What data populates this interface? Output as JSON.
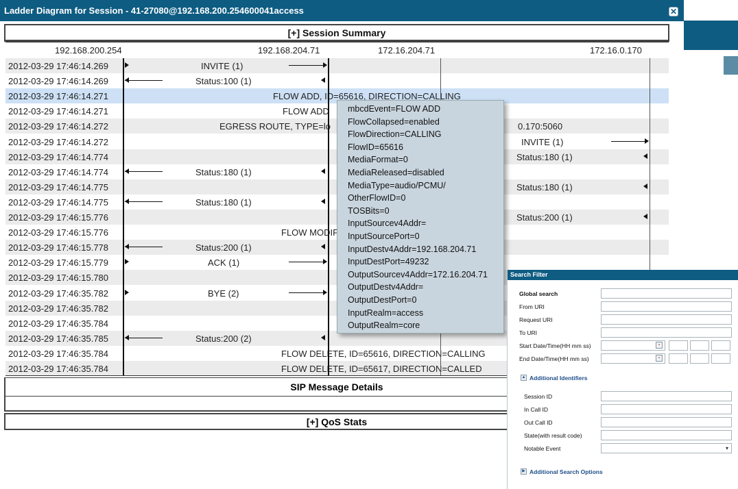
{
  "window": {
    "title": "Ladder Diagram for Session - 41-27080@192.168.200.254600041access",
    "close_glyph": "✕"
  },
  "sections": {
    "session_summary": "[+] Session Summary",
    "sip_details": "SIP Message Details",
    "qos_stats": "[+] QoS Stats"
  },
  "ladder": {
    "ips": [
      "192.168.200.254",
      "192.168.204.71",
      "172.16.204.71",
      "172.16.0.170"
    ],
    "rows": [
      {
        "ts": "2012-03-29 17:46:14.269",
        "label": "INVITE (1)"
      },
      {
        "ts": "2012-03-29 17:46:14.269",
        "label": "Status:100 (1)"
      },
      {
        "ts": "2012-03-29 17:46:14.271",
        "label": "FLOW ADD, ID=65616, DIRECTION=CALLING"
      },
      {
        "ts": "2012-03-29 17:46:14.271",
        "label": "FLOW ADD"
      },
      {
        "ts": "2012-03-29 17:46:14.272",
        "label": "EGRESS ROUTE, TYPE=lo",
        "label2": "0.170:5060"
      },
      {
        "ts": "2012-03-29 17:46:14.272",
        "label": "INVITE (1)"
      },
      {
        "ts": "2012-03-29 17:46:14.774",
        "label": "Status:180 (1)"
      },
      {
        "ts": "2012-03-29 17:46:14.774",
        "label": "Status:180 (1)"
      },
      {
        "ts": "2012-03-29 17:46:14.775",
        "label": "Status:180 (1)"
      },
      {
        "ts": "2012-03-29 17:46:14.775",
        "label": "Status:180 (1)"
      },
      {
        "ts": "2012-03-29 17:46:15.776",
        "label": "Status:200 (1)"
      },
      {
        "ts": "2012-03-29 17:46:15.776",
        "label": "FLOW MODIF"
      },
      {
        "ts": "2012-03-29 17:46:15.778",
        "label": "Status:200 (1)"
      },
      {
        "ts": "2012-03-29 17:46:15.779",
        "label": "ACK (1)"
      },
      {
        "ts": "2012-03-29 17:46:15.780",
        "label": ""
      },
      {
        "ts": "2012-03-29 17:46:35.782",
        "label": "BYE (2)"
      },
      {
        "ts": "2012-03-29 17:46:35.782",
        "label": ""
      },
      {
        "ts": "2012-03-29 17:46:35.784",
        "label": ""
      },
      {
        "ts": "2012-03-29 17:46:35.785",
        "label": "Status:200 (2)"
      },
      {
        "ts": "2012-03-29 17:46:35.784",
        "label": "FLOW DELETE, ID=65616, DIRECTION=CALLING"
      },
      {
        "ts": "2012-03-29 17:46:35.784",
        "label": "FLOW DELETE, ID=65617, DIRECTION=CALLED"
      }
    ]
  },
  "tooltip": {
    "lines": [
      "mbcdEvent=FLOW ADD",
      "FlowCollapsed=enabled",
      "FlowDirection=CALLING",
      "FlowID=65616",
      "MediaFormat=0",
      "MediaReleased=disabled",
      "MediaType=audio/PCMU/",
      "OtherFlowID=0",
      "TOSBits=0",
      "InputSourcev4Addr=",
      "InputSourcePort=0",
      "InputDestv4Addr=192.168.204.71",
      "InputDestPort=49232",
      "OutputSourcev4Addr=172.16.204.71",
      "OutputDestv4Addr=",
      "OutputDestPort=0",
      "InputRealm=access",
      "OutputRealm=core"
    ]
  },
  "search_filter": {
    "title": "Search Filter",
    "global_search": "Global search",
    "from_uri": "From URI",
    "request_uri": "Request URI",
    "to_uri": "To URI",
    "start_date": "Start Date/Time(HH mm ss)",
    "end_date": "End Date/Time(HH mm ss)",
    "additional_identifiers": "Additional Identifiers",
    "session_id": "Session ID",
    "in_call_id": "In Call ID",
    "out_call_id": "Out Call ID",
    "state": "State(with result code)",
    "notable_event": "Notable Event",
    "additional_search_options": "Additional Search Options"
  },
  "colors": {
    "titlebar": "#0e5c82",
    "row_alt": "#ebebeb",
    "row_highlight": "#cde0f5",
    "tooltip_bg": "#c9d5de"
  }
}
